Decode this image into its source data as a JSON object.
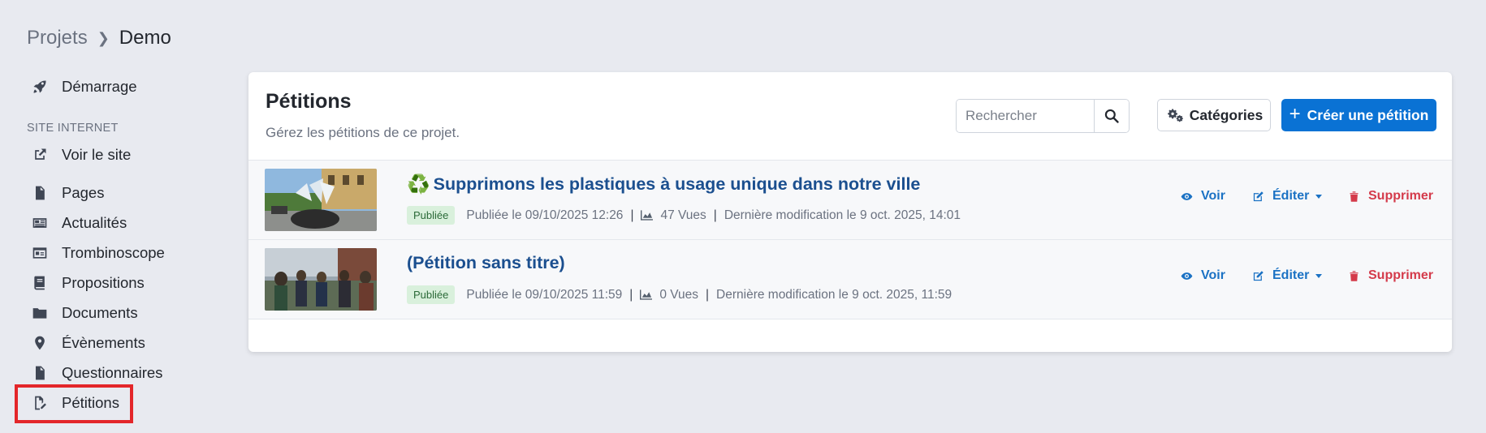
{
  "breadcrumb": {
    "parent": "Projets",
    "current": "Demo"
  },
  "sidebar": {
    "start": {
      "label": "Démarrage",
      "icon": "rocket-icon"
    },
    "section_label": "SITE INTERNET",
    "items": [
      {
        "label": "Voir le site",
        "icon": "external-link-icon"
      },
      {
        "label": "Pages",
        "icon": "file-icon"
      },
      {
        "label": "Actualités",
        "icon": "newspaper-icon"
      },
      {
        "label": "Trombinoscope",
        "icon": "id-card-icon"
      },
      {
        "label": "Propositions",
        "icon": "book-icon"
      },
      {
        "label": "Documents",
        "icon": "folder-icon"
      },
      {
        "label": "Évènements",
        "icon": "map-pin-icon"
      },
      {
        "label": "Questionnaires",
        "icon": "file-signature-icon"
      },
      {
        "label": "Pétitions",
        "icon": "file-pen-icon",
        "active": true
      }
    ]
  },
  "main": {
    "title": "Pétitions",
    "subtitle": "Gérez les pétitions de ce projet.",
    "search": {
      "placeholder": "Rechercher",
      "value": ""
    },
    "categories_label": "Catégories",
    "create_label": "Créer une pétition",
    "petitions": [
      {
        "title": "Supprimons les plastiques à usage unique dans notre ville",
        "title_emoji": "♻️",
        "status": "Publiée",
        "published": "Publiée le 09/10/2025 12:26",
        "views": "47 Vues",
        "modified": "Dernière modification le 9 oct. 2025, 14:01"
      },
      {
        "title": "(Pétition sans titre)",
        "status": "Publiée",
        "published": "Publiée le 09/10/2025 11:59",
        "views": "0 Vues",
        "modified": "Dernière modification le 9 oct. 2025, 11:59"
      }
    ],
    "actions": {
      "view": "Voir",
      "edit": "Éditer",
      "delete": "Supprimer"
    }
  },
  "colors": {
    "primary": "#0a72d4",
    "link": "#1b4f8f",
    "danger": "#d43a4a",
    "badge_bg": "#d9f0dc",
    "highlight": "#e3262a"
  }
}
